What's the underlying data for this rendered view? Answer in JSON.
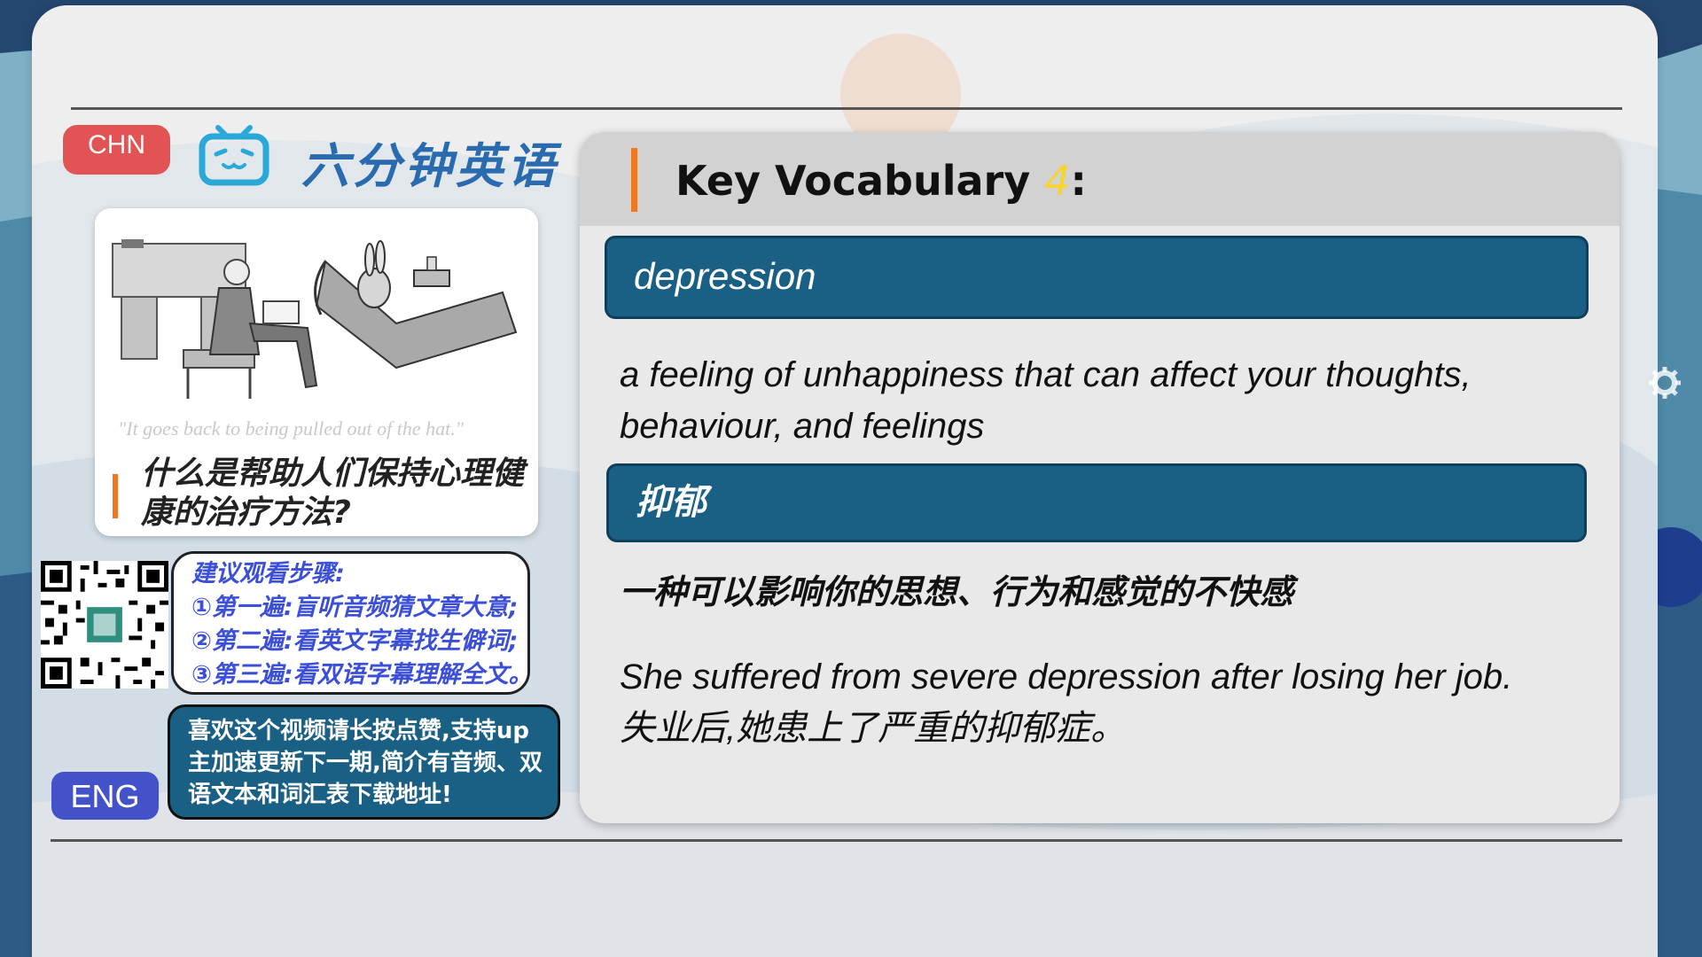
{
  "header": {
    "lang_button": "CHN",
    "brand_icon": "tv-icon",
    "brand_title": "六分钟英语"
  },
  "cartoon": {
    "caption": "\"It goes back to being pulled out of the hat.\"",
    "question": "什么是帮助人们保持心理健康的治疗方法?"
  },
  "steps": {
    "title": "建议观看步骤:",
    "items": [
      "①第一遍:盲听音频猜文章大意;",
      "②第二遍:看英文字幕找生僻词;",
      "③第三遍:看双语字幕理解全文。"
    ]
  },
  "promo": {
    "text": "喜欢这个视频请长按点赞,支持up主加速更新下一期,简介有音频、双语文本和词汇表下载地址!"
  },
  "eng_button": "ENG",
  "vocab": {
    "title": "Key Vocabulary",
    "number": "4",
    "suffix": ":",
    "word_en": "depression",
    "definition_en": "a feeling of unhappiness that can affect your thoughts, behaviour, and feelings",
    "word_cn": "抑郁",
    "definition_cn": "一种可以影响你的思想、行为和感觉的不快感",
    "example": "She suffered from severe depression after losing her job.失业后,她患上了严重的抑郁症。"
  },
  "colors": {
    "accent_orange": "#f07820",
    "vocab_bar": "#1a5f84",
    "chn_red": "#e25454",
    "eng_blue": "#4352c9",
    "steps_text": "#3b4fd8",
    "number_yellow": "#f7d52e"
  }
}
